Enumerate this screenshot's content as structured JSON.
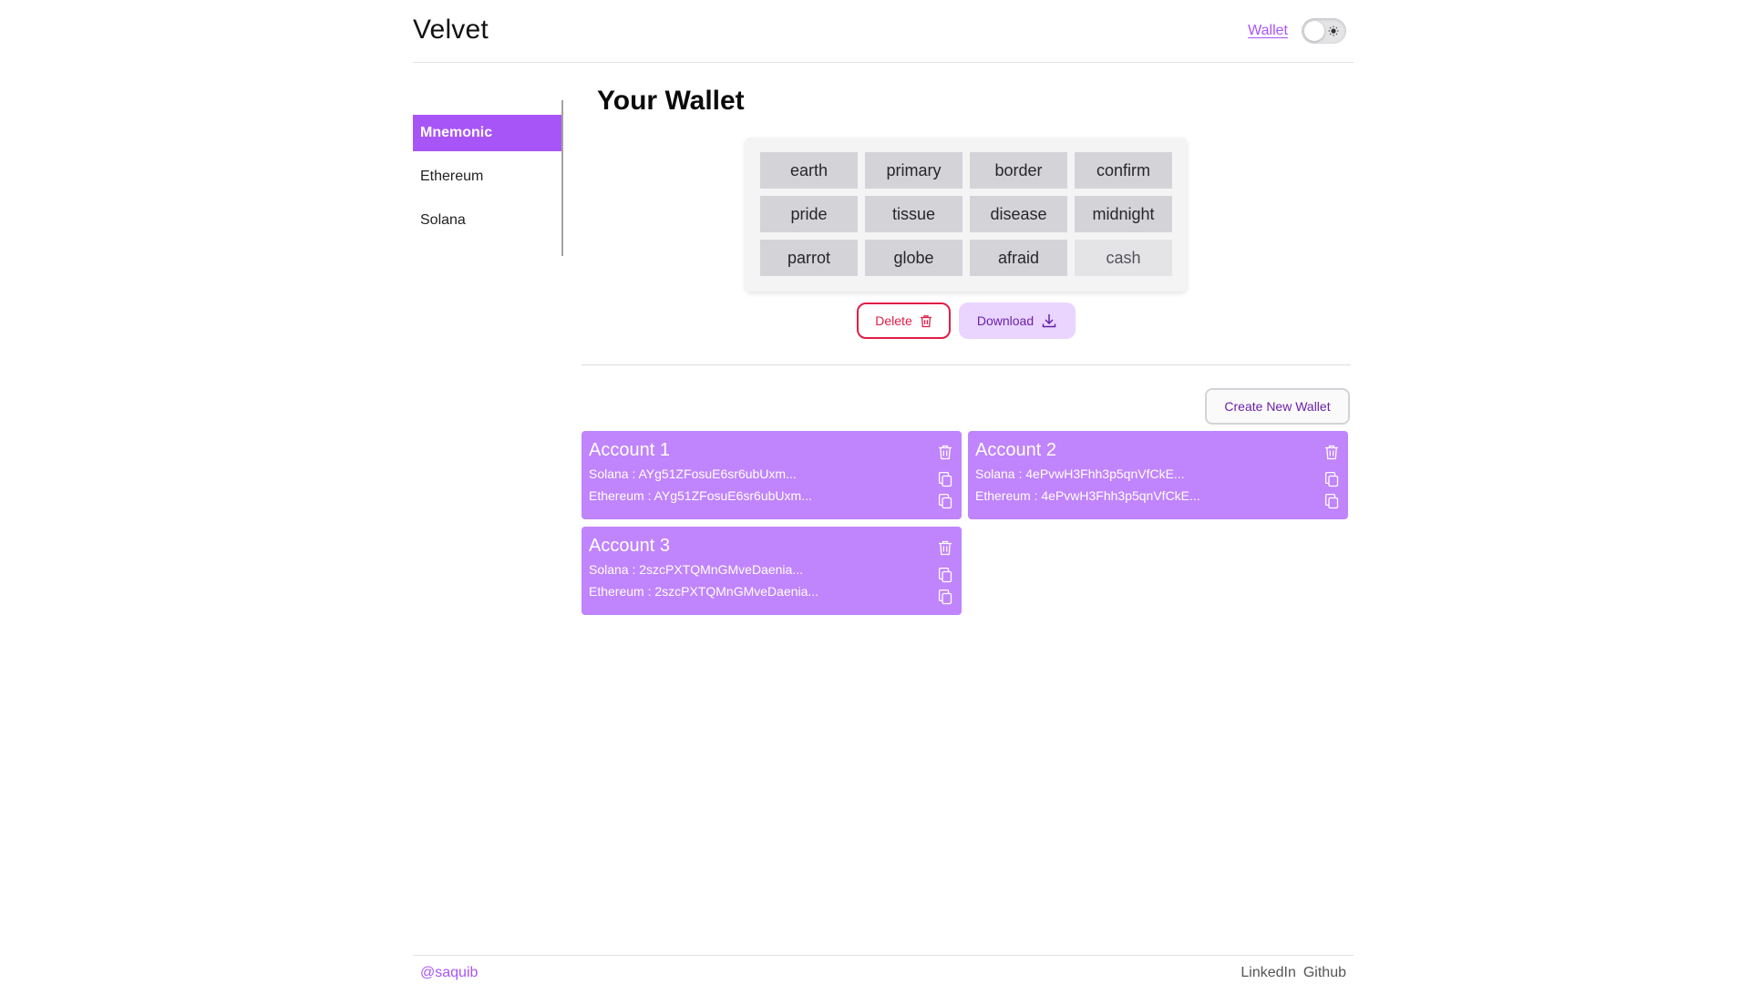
{
  "header": {
    "brand": "Velvet",
    "nav_link": "Wallet",
    "theme_toggle": "off"
  },
  "sidebar": {
    "items": [
      {
        "label": "Mnemonic",
        "active": true
      },
      {
        "label": "Ethereum",
        "active": false
      },
      {
        "label": "Solana",
        "active": false
      }
    ]
  },
  "main": {
    "title": "Your Wallet",
    "mnemonic_words": [
      "earth",
      "primary",
      "border",
      "confirm",
      "pride",
      "tissue",
      "disease",
      "midnight",
      "parrot",
      "globe",
      "afraid",
      "cash"
    ],
    "delete_label": "Delete",
    "download_label": "Download",
    "create_wallet_label": "Create New Wallet"
  },
  "accounts": [
    {
      "title": "Account 1",
      "solana": "Solana : AYg51ZFosuE6sr6ubUxm...",
      "ethereum": "Ethereum : AYg51ZFosuE6sr6ubUxm..."
    },
    {
      "title": "Account 2",
      "solana": "Solana : 4ePvwH3Fhh3p5qnVfCkE...",
      "ethereum": "Ethereum : 4ePvwH3Fhh3p5qnVfCkE..."
    },
    {
      "title": "Account 3",
      "solana": "Solana : 2szcPXTQMnGMveDaenia...",
      "ethereum": "Ethereum : 2szcPXTQMnGMveDaenia..."
    }
  ],
  "footer": {
    "handle": "@saquib",
    "links": [
      "LinkedIn",
      "Github"
    ]
  },
  "colors": {
    "accent": "#a855f7",
    "card": "#c084fc",
    "danger": "#e11d48",
    "download_bg": "#e9d5ff"
  }
}
